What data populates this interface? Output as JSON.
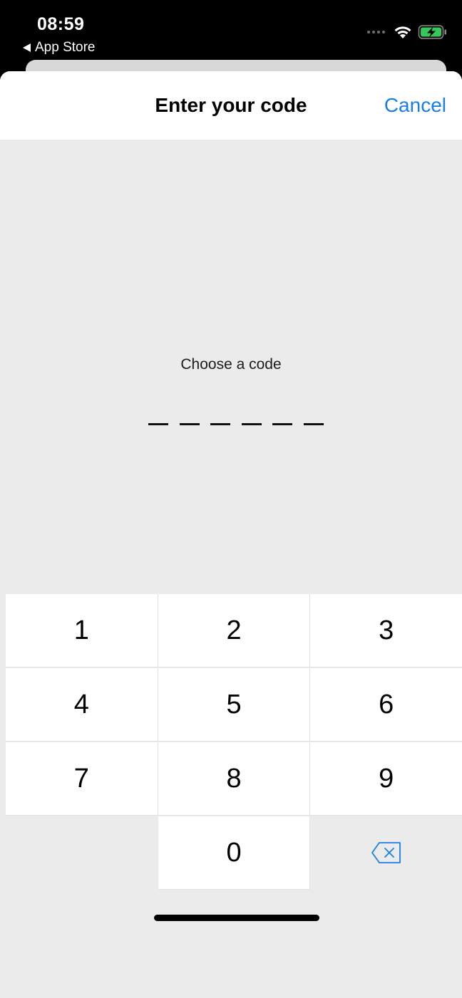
{
  "status_bar": {
    "time": "08:59",
    "back_label": "App Store",
    "battery_color": "#34c759"
  },
  "nav": {
    "title": "Enter your code",
    "cancel_label": "Cancel",
    "accent": "#1a7ee8"
  },
  "code_entry": {
    "prompt": "Choose a code",
    "digits_total": 6,
    "digits_entered": 0
  },
  "keypad": {
    "rows": [
      [
        "1",
        "2",
        "3"
      ],
      [
        "4",
        "5",
        "6"
      ],
      [
        "7",
        "8",
        "9"
      ],
      [
        "",
        "0",
        "delete-icon"
      ]
    ]
  }
}
